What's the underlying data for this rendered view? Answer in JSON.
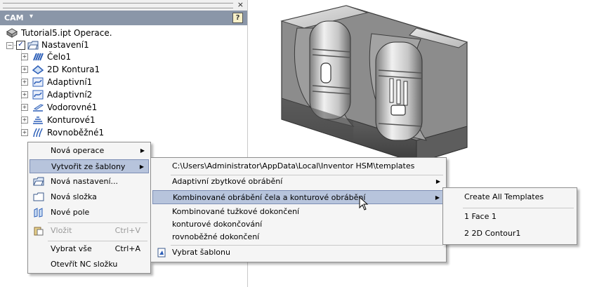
{
  "panel": {
    "close_glyph": "×",
    "title": "CAM",
    "title_caret": "▾",
    "help_glyph": "?",
    "tree": {
      "root_label": "Tutorial5.ipt Operace.",
      "setup_label": "Nastavení1",
      "expander_minus": "−",
      "expander_plus": "+",
      "check_glyph": "✓",
      "operations": [
        {
          "label": "Čelo1",
          "icon": "face-op-icon"
        },
        {
          "label": "2D Kontura1",
          "icon": "contour2d-op-icon"
        },
        {
          "label": "Adaptivní1",
          "icon": "adaptive-op-icon"
        },
        {
          "label": "Adaptivní2",
          "icon": "adaptive-op-icon"
        },
        {
          "label": "Vodorovné1",
          "icon": "horizontal-op-icon"
        },
        {
          "label": "Konturové1",
          "icon": "contour-op-icon"
        },
        {
          "label": "Rovnoběžné1",
          "icon": "parallel-op-icon"
        }
      ]
    }
  },
  "context_menu": {
    "items": [
      {
        "label": "Nová operace",
        "submenu": true
      },
      {
        "label": "Vytvořit ze šablony",
        "submenu": true,
        "highlighted": true
      },
      {
        "label": "Nová nastavení...",
        "icon": "open-folder-icon"
      },
      {
        "label": "Nová složka",
        "icon": "folder-icon"
      },
      {
        "label": "Nové pole",
        "icon": "pattern-icon"
      },
      {
        "label": "Vložit",
        "shortcut": "Ctrl+V",
        "disabled": true,
        "icon": "paste-icon"
      },
      {
        "label": "Vybrat vše",
        "shortcut": "Ctrl+A"
      },
      {
        "label": "Otevřít NC složku"
      }
    ]
  },
  "template_menu": {
    "path_label": "C:\\Users\\Administrator\\AppData\\Local\\Inventor HSM\\templates",
    "items": [
      {
        "label": "Adaptivní zbytkové obrábění",
        "submenu": true
      },
      {
        "label": "Kombinované obrábění čela a konturové obrábění",
        "submenu": true,
        "highlighted": true
      },
      {
        "label": "Kombinované tužkové dokončení"
      },
      {
        "label": "konturové dokončování"
      },
      {
        "label": "rovnoběžné dokončení"
      }
    ],
    "browse_label": "Vybrat šablonu"
  },
  "combo_menu": {
    "items": [
      {
        "label": "Create All Templates"
      },
      {
        "label": "1 Face 1"
      },
      {
        "label": "2 2D Contour1"
      }
    ]
  },
  "submenu_arrow": "▶",
  "colors": {
    "header_bg": "#8a96a8",
    "highlight_bg": "#b7c4dc",
    "highlight_border": "#7d8eb5",
    "menu_bg": "#f5f5f5",
    "model_metal": "#a9a9a9"
  }
}
